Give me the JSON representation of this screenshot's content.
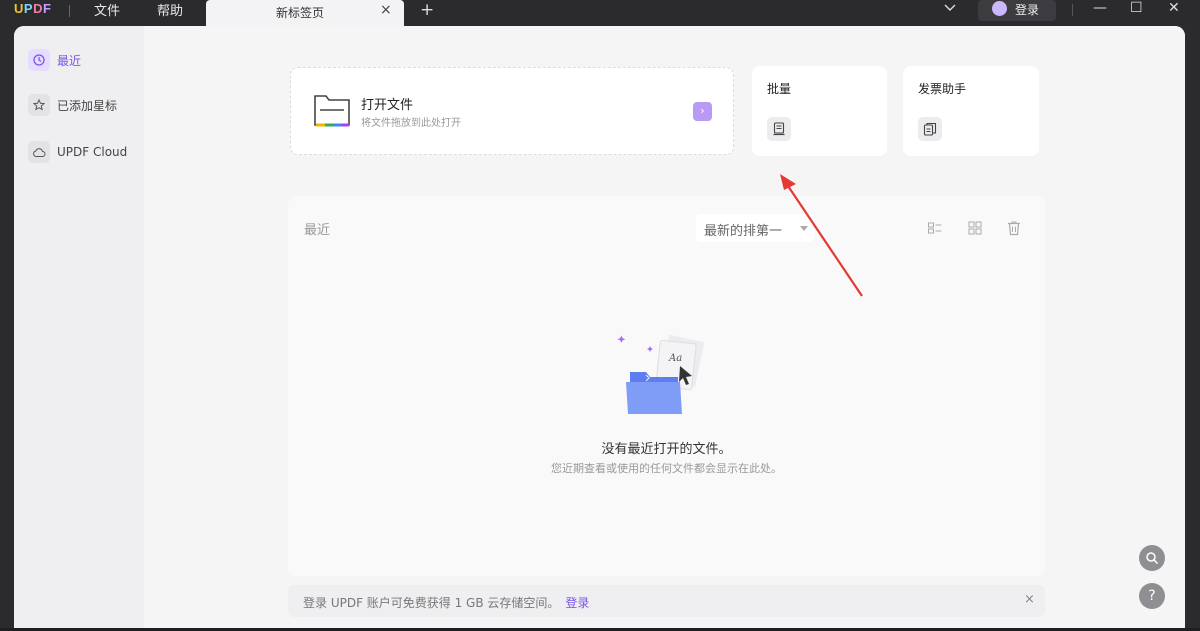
{
  "app": {
    "logo": "UPDF"
  },
  "menu": {
    "file": "文件",
    "help": "帮助"
  },
  "tab": {
    "title": "新标签页",
    "close": "×"
  },
  "titlebar": {
    "new_tab": "+",
    "login": "登录",
    "minimize": "—",
    "maximize": "☐",
    "close": "✕"
  },
  "sidebar": {
    "items": [
      {
        "label": "最近",
        "icon": "clock-icon",
        "active": true
      },
      {
        "label": "已添加星标",
        "icon": "star-icon",
        "active": false
      },
      {
        "label": "UPDF Cloud",
        "icon": "cloud-icon",
        "active": false
      }
    ]
  },
  "open_file": {
    "title": "打开文件",
    "subtitle": "将文件拖放到此处打开",
    "icon": "folder-icon"
  },
  "batch": {
    "title": "批量",
    "icon": "stack-document-icon"
  },
  "invoice": {
    "title": "发票助手",
    "icon": "invoice-icon"
  },
  "recent": {
    "label": "最近",
    "sort": "最新的排第一",
    "empty_title": "没有最近打开的文件。",
    "empty_subtitle": "您近期查看或使用的任何文件都会显示在此处。"
  },
  "banner": {
    "text": "登录 UPDF 账户可免费获得 1 GB 云存储空间。",
    "link": "登录",
    "close": "×"
  },
  "colors": {
    "accent": "#7b55e8",
    "annotation_arrow": "#e53935"
  }
}
